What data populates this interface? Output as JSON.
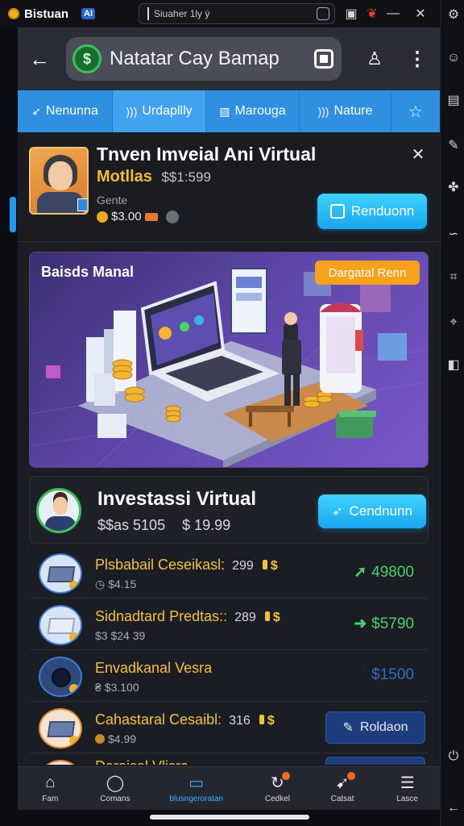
{
  "window": {
    "app_name": "Bistuan",
    "ai_badge": "AI",
    "search_text": "Siuaher 1ly ý"
  },
  "appbar": {
    "title": "Natatar Cay Bamap"
  },
  "tabs": [
    {
      "label": "Nenunna",
      "icon": "leaf-icon"
    },
    {
      "label": "Urdapllly",
      "icon": "wave-icon"
    },
    {
      "label": "Marouga",
      "icon": "image-icon"
    },
    {
      "label": "Nature",
      "icon": "wave-icon"
    },
    {
      "label": "",
      "icon": "star-icon"
    }
  ],
  "header": {
    "title": "Tnven Imveial Ani Virtual",
    "subtitle_gold": "Motllas",
    "subtitle_price": "$$1:599",
    "genre": "Gente",
    "price": "$3.00",
    "button_label": "Renduonn"
  },
  "hero": {
    "label": "Baisds Manal",
    "pill": "Dargatal Renn"
  },
  "investasi": {
    "title": "Investassi Virtual",
    "price_a": "$$as 5105",
    "price_b": "$ 19.99",
    "button_label": "Cendnunn"
  },
  "items": [
    {
      "title": "Plsbabail Ceseikasl:",
      "qty": "299",
      "sub": "$4.15",
      "value": "49800",
      "trend": "up",
      "color": "#4ad168"
    },
    {
      "title": "Sidnadtard Predtas::",
      "qty": "289",
      "sub": "$3 $24 39",
      "value": "$5790",
      "trend": "right",
      "color": "#4ad168"
    },
    {
      "title": "Envadkanal Vesra",
      "qty": "",
      "sub": "$3.100",
      "value": "$1500",
      "trend": "",
      "color": "#2f6fbf"
    },
    {
      "title": "Cahastaral Cesaibl:",
      "qty": "316",
      "sub": "$4.99",
      "value": "",
      "trend": "",
      "color": "",
      "button_label": "Roldaon"
    },
    {
      "title": "Daraisal Vlisra",
      "qty": "",
      "sub": "",
      "value": "",
      "trend": "",
      "color": ""
    }
  ],
  "bottom_nav": [
    {
      "label": "Fam",
      "icon": "home-icon"
    },
    {
      "label": "Comans",
      "icon": "chat-icon"
    },
    {
      "label": "blusngeroratan",
      "icon": "tv-icon",
      "active": true
    },
    {
      "label": "Cedkel",
      "icon": "refresh-icon"
    },
    {
      "label": "Catsat",
      "icon": "rocket-icon"
    },
    {
      "label": "Lasce",
      "icon": "list-icon"
    }
  ],
  "colors": {
    "accent": "#2f8fe0",
    "cyan_button": "#18a6ee",
    "gold": "#f3bd2f",
    "positive": "#4ad168"
  }
}
